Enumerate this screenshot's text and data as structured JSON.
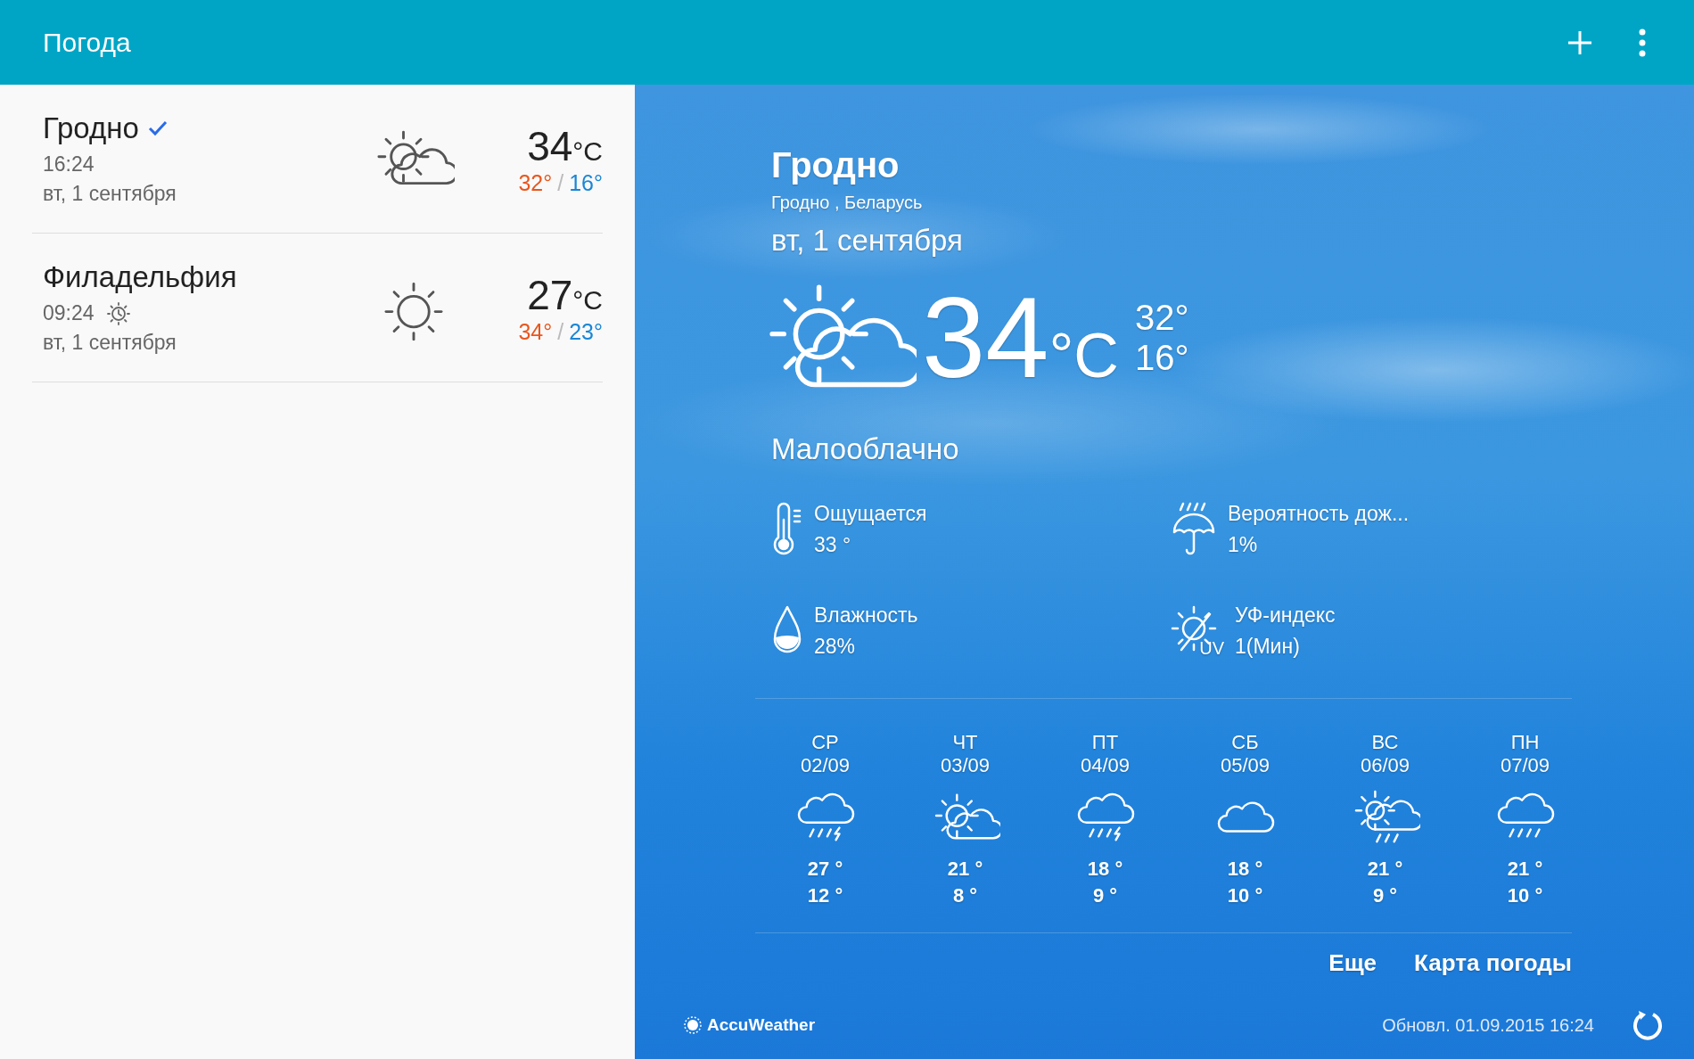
{
  "app_bar": {
    "title": "Погода",
    "actions": [
      {
        "kind": "add"
      },
      {
        "kind": "more"
      }
    ]
  },
  "cities": [
    {
      "name": "Гродно",
      "selected": true,
      "time": "16:24",
      "local_time_icon": false,
      "date": "вт, 1 сентября",
      "kind": "partly-cloudy",
      "temp": "34",
      "unit": "°C",
      "high": "32°",
      "separator": "/",
      "low": "16°"
    },
    {
      "name": "Филадельфия",
      "selected": false,
      "time": "09:24",
      "local_time_icon": true,
      "date": "вт, 1 сентября",
      "kind": "sunny",
      "temp": "27",
      "unit": "°C",
      "high": "34°",
      "separator": "/",
      "low": "23°"
    }
  ],
  "detail": {
    "city": "Гродно",
    "location": "Гродно , Беларусь",
    "date": "вт, 1 сентября",
    "kind": "partly-cloudy",
    "temp": "34",
    "unit": "°C",
    "high": "32°",
    "low": "16°",
    "condition": "Малооблачно",
    "metrics": [
      {
        "kind": "feels-like",
        "label": "Ощущается",
        "value": "33 °"
      },
      {
        "kind": "rain",
        "label": "Вероятность дож...",
        "value": "1%"
      },
      {
        "kind": "humidity",
        "label": "Влажность",
        "value": "28%"
      },
      {
        "kind": "uv",
        "label": "УФ-индекс",
        "value": "1(Мин)",
        "icon_text": "UV"
      }
    ],
    "forecast": [
      {
        "day": "СР",
        "date": "02/09",
        "kind": "storm",
        "high": "27 °",
        "low": "12 °"
      },
      {
        "day": "ЧТ",
        "date": "03/09",
        "kind": "partly-cloudy",
        "high": "21 °",
        "low": "8 °"
      },
      {
        "day": "ПТ",
        "date": "04/09",
        "kind": "storm",
        "high": "18 °",
        "low": "9 °"
      },
      {
        "day": "СБ",
        "date": "05/09",
        "kind": "cloudy",
        "high": "18 °",
        "low": "10 °"
      },
      {
        "day": "ВС",
        "date": "06/09",
        "kind": "partly-cloudy-rain",
        "high": "21 °",
        "low": "9 °"
      },
      {
        "day": "ПН",
        "date": "07/09",
        "kind": "rain",
        "high": "21 °",
        "low": "10 °"
      }
    ],
    "links": [
      "Еще",
      "Карта погоды"
    ],
    "provider": "AccuWeather",
    "updated": "Обновл. 01.09.2015 16:24"
  }
}
